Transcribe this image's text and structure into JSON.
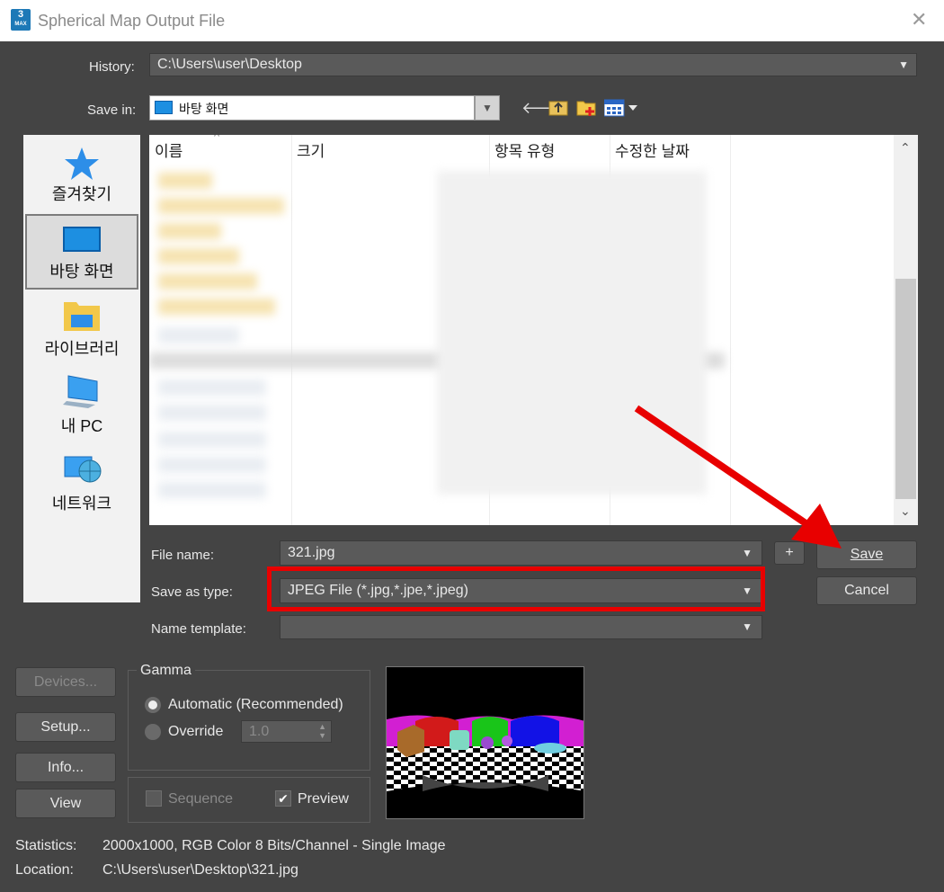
{
  "window": {
    "title": "Spherical Map Output File",
    "app_icon": "3dsmax-icon",
    "icon_digit": "3",
    "icon_caption": "MAX"
  },
  "history": {
    "label": "History:",
    "value": "C:\\Users\\user\\Desktop"
  },
  "save_in": {
    "label": "Save in:",
    "value": "바탕 화면",
    "toolbar_icons": [
      "back-arrow-icon",
      "up-folder-icon",
      "new-folder-icon",
      "view-menu-icon"
    ]
  },
  "places": [
    {
      "label": "즐겨찾기",
      "icon": "star-icon"
    },
    {
      "label": "바탕 화면",
      "icon": "desktop-icon",
      "selected": true
    },
    {
      "label": "라이브러리",
      "icon": "library-icon"
    },
    {
      "label": "내 PC",
      "icon": "computer-icon"
    },
    {
      "label": "네트워크",
      "icon": "network-icon"
    }
  ],
  "file_list": {
    "columns": [
      "이름",
      "크기",
      "항목 유형",
      "수정한 날짜"
    ],
    "sort_indicator": "^"
  },
  "file_name": {
    "label": "File name:",
    "value": "321.jpg",
    "plus_label": "+"
  },
  "save_as_type": {
    "label": "Save as type:",
    "value": "JPEG File (*.jpg,*.jpe,*.jpeg)"
  },
  "name_template": {
    "label": "Name template:",
    "value": ""
  },
  "buttons": {
    "save": "Save",
    "cancel": "Cancel",
    "devices": "Devices...",
    "setup": "Setup...",
    "info": "Info...",
    "view": "View"
  },
  "gamma": {
    "title": "Gamma",
    "automatic": "Automatic (Recommended)",
    "override": "Override",
    "override_value": "1.0"
  },
  "options": {
    "sequence": "Sequence",
    "preview": "Preview",
    "preview_checked": true
  },
  "statistics": {
    "label": "Statistics:",
    "value": "2000x1000, RGB Color 8 Bits/Channel - Single Image"
  },
  "location": {
    "label": "Location:",
    "value": "C:\\Users\\user\\Desktop\\321.jpg"
  },
  "colors": {
    "annotation": "#e80000",
    "dialog_bg": "#444444"
  }
}
